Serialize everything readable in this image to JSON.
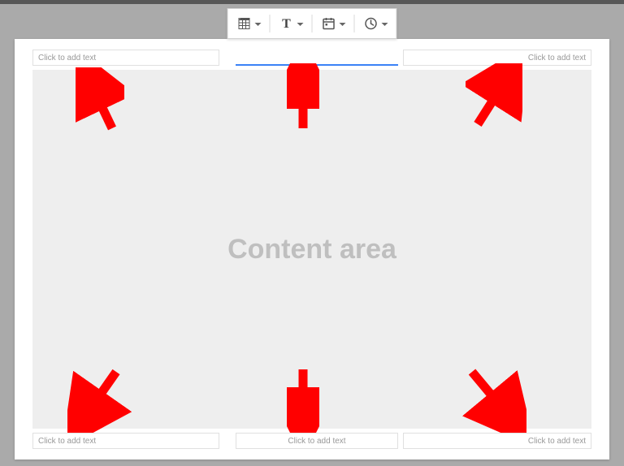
{
  "toolbar": {
    "icons": {
      "table": "table-icon",
      "text": "text-icon",
      "date": "date-icon",
      "time": "time-icon"
    }
  },
  "header": {
    "left": "Click to add text",
    "center": "",
    "right": "Click to add text"
  },
  "footer": {
    "left": "Click to add text",
    "center": "Click to add text",
    "right": "Click to add text"
  },
  "content": {
    "watermark": "Content area"
  },
  "colors": {
    "arrow": "#ff0000",
    "active_underline": "#3b82f6",
    "placeholder": "#999999",
    "watermark": "#bfbfbf",
    "background": "#aaaaaa"
  }
}
